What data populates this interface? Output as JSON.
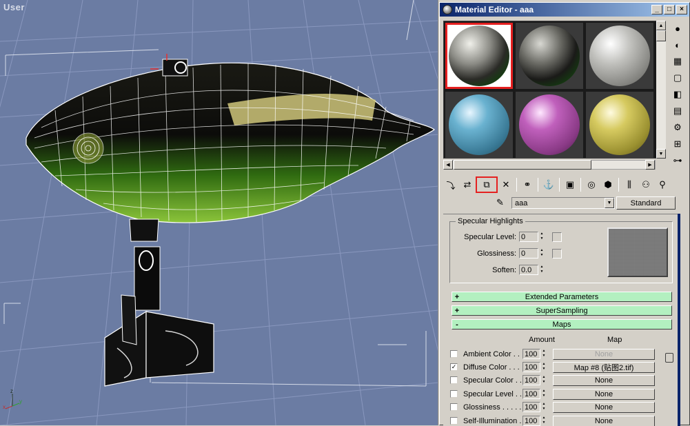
{
  "viewport": {
    "label": "User",
    "axis": {
      "x": "x",
      "y": "y",
      "z": "z"
    }
  },
  "material_editor": {
    "title": "Material Editor - aaa",
    "window_buttons": {
      "minimize": "_",
      "maximize": "□",
      "close": "×"
    },
    "slots": [
      {
        "name": "slot-1",
        "active": true,
        "color": "#6e6e66"
      },
      {
        "name": "slot-2",
        "active": false,
        "color": "#555550"
      },
      {
        "name": "slot-3",
        "active": false,
        "color": "#b8b8b4"
      },
      {
        "name": "slot-4",
        "active": false,
        "color": "#5fa4c0"
      },
      {
        "name": "slot-5",
        "active": false,
        "color": "#b45cb0"
      },
      {
        "name": "slot-6",
        "active": false,
        "color": "#c8bc58"
      }
    ],
    "material_name": "aaa",
    "material_type": "Standard",
    "specular_highlights": {
      "title": "Specular Highlights",
      "specular_level_label": "Specular Level:",
      "specular_level": "0",
      "glossiness_label": "Glossiness:",
      "glossiness": "0",
      "soften_label": "Soften:",
      "soften": "0.0"
    },
    "rollouts": [
      {
        "sign": "+",
        "label": "Extended Parameters"
      },
      {
        "sign": "+",
        "label": "SuperSampling"
      },
      {
        "sign": "-",
        "label": "Maps"
      }
    ],
    "maps": {
      "amount_header": "Amount",
      "map_header": "Map",
      "rows": [
        {
          "label": "Ambient Color . .",
          "checked": false,
          "amount": "100",
          "map": "None",
          "dim": true
        },
        {
          "label": "Diffuse Color . . .",
          "checked": true,
          "amount": "100",
          "map": "Map #8 (贴图2.tif)",
          "dim": false
        },
        {
          "label": "Specular Color . .",
          "checked": false,
          "amount": "100",
          "map": "None",
          "dim": false
        },
        {
          "label": "Specular Level . .",
          "checked": false,
          "amount": "100",
          "map": "None",
          "dim": false
        },
        {
          "label": "Glossiness . . . . .",
          "checked": false,
          "amount": "100",
          "map": "None",
          "dim": false
        },
        {
          "label": "Self-Illumination .",
          "checked": false,
          "amount": "100",
          "map": "None",
          "dim": false
        }
      ]
    },
    "colors": {
      "title_bar_start": "#0a246a",
      "rollout_bg": "#b3f0c0",
      "highlight_red": "#e52020"
    }
  }
}
